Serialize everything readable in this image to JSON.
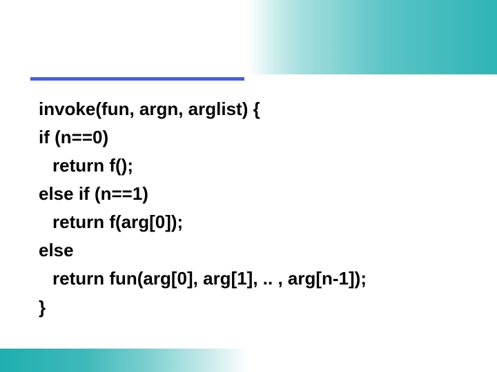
{
  "code": {
    "l1": "invoke(fun, argn, arglist) {",
    "l2": "if (n==0)",
    "l3": "return f();",
    "l4": "else if (n==1)",
    "l5": "return f(arg[0]);",
    "l6": "else",
    "l7": "return fun(arg[0], arg[1], .. , arg[n-1]);",
    "l8": "}"
  }
}
